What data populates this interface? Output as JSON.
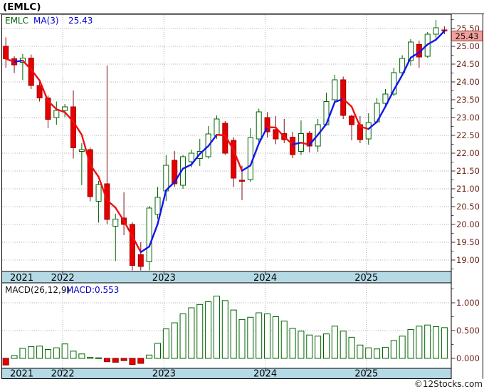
{
  "page": {
    "title": "(EMLC)",
    "copyright": "©12Stocks.com"
  },
  "main_chart": {
    "legend": {
      "symbol": "EMLC",
      "ma_label": "MA(3)",
      "ma_value": "25.43"
    },
    "last_price_box": "25.43",
    "y_axis": {
      "labels": [
        "25.50",
        "25.00",
        "24.50",
        "24.00",
        "23.50",
        "23.00",
        "22.50",
        "22.00",
        "21.50",
        "21.00",
        "20.50",
        "20.00",
        "19.50",
        "19.00"
      ]
    },
    "x_axis": {
      "labels": [
        "2021",
        "2022",
        "2023",
        "2024",
        "2025"
      ]
    }
  },
  "macd_panel": {
    "legend": {
      "label": "MACD(26,12,9)",
      "value": "MACD:0.553"
    },
    "y_axis": {
      "labels": [
        "1.000",
        "0.500",
        "0.000"
      ]
    },
    "x_axis": {
      "labels": [
        "2021",
        "2022",
        "2023",
        "2024",
        "2025"
      ]
    }
  },
  "colors": {
    "up_outline": "#006400",
    "down_fill": "#E60000",
    "down_edge": "#A00000",
    "wick_up": "#006400",
    "wick_down": "#7E0E10",
    "ma_up": "#1414EE",
    "ma_down": "#EE1010",
    "axis_label": "#6E241C",
    "year_label": "#000000",
    "strip_bg": "#B5DAE6",
    "grid": "#B0B0B0",
    "frame": "#000000",
    "price_box_bg": "#F1A09C",
    "price_box_border": "#9E3A33",
    "legend_symbol": "#006400",
    "legend_blue": "#0000CC",
    "macd_neg_fill": "#E60000",
    "macd_neg_edge": "#8B0000"
  },
  "chart_data": [
    {
      "type": "candlestick",
      "title": "(EMLC) monthly candlesticks with MA(3) overlay (line blue when rising, red when falling)",
      "x": [
        "2021-06",
        "2021-07",
        "2021-08",
        "2021-09",
        "2021-10",
        "2021-11",
        "2021-12",
        "2022-01",
        "2022-02",
        "2022-03",
        "2022-04",
        "2022-05",
        "2022-06",
        "2022-07",
        "2022-08",
        "2022-09",
        "2022-10",
        "2022-11",
        "2022-12",
        "2023-01",
        "2023-02",
        "2023-03",
        "2023-04",
        "2023-05",
        "2023-06",
        "2023-07",
        "2023-08",
        "2023-09",
        "2023-10",
        "2023-11",
        "2023-12",
        "2024-01",
        "2024-02",
        "2024-03",
        "2024-04",
        "2024-05",
        "2024-06",
        "2024-07",
        "2024-08",
        "2024-09",
        "2024-10",
        "2024-11",
        "2024-12",
        "2025-01",
        "2025-02",
        "2025-03",
        "2025-04",
        "2025-05",
        "2025-06",
        "2025-07",
        "2025-08",
        "2025-09",
        "2025-10"
      ],
      "ohlc": [
        [
          25.0,
          25.25,
          24.4,
          24.65
        ],
        [
          24.65,
          24.72,
          24.25,
          24.48
        ],
        [
          24.55,
          24.78,
          24.05,
          24.67
        ],
        [
          24.67,
          24.77,
          23.8,
          23.9
        ],
        [
          23.9,
          24.0,
          23.45,
          23.55
        ],
        [
          23.55,
          23.62,
          22.7,
          22.95
        ],
        [
          23.0,
          23.45,
          22.8,
          23.2
        ],
        [
          23.2,
          23.38,
          23.02,
          23.3
        ],
        [
          23.3,
          23.76,
          21.85,
          22.15
        ],
        [
          22.05,
          22.28,
          21.1,
          22.1
        ],
        [
          22.1,
          22.16,
          20.65,
          20.78
        ],
        [
          20.65,
          21.22,
          20.05,
          21.12
        ],
        [
          21.14,
          24.46,
          20.0,
          20.14
        ],
        [
          19.95,
          20.3,
          18.97,
          20.15
        ],
        [
          20.18,
          20.9,
          19.7,
          20.0
        ],
        [
          20.0,
          20.06,
          18.7,
          18.85
        ],
        [
          19.15,
          19.5,
          18.62,
          18.82
        ],
        [
          18.95,
          20.52,
          18.66,
          20.46
        ],
        [
          20.28,
          21.05,
          20.15,
          20.76
        ],
        [
          20.94,
          21.94,
          20.66,
          21.66
        ],
        [
          21.8,
          22.06,
          21.05,
          21.14
        ],
        [
          21.1,
          21.95,
          21.0,
          21.9
        ],
        [
          21.76,
          22.1,
          21.6,
          22.0
        ],
        [
          21.85,
          22.4,
          21.64,
          22.05
        ],
        [
          21.9,
          22.76,
          21.85,
          22.54
        ],
        [
          22.5,
          23.06,
          22.4,
          22.96
        ],
        [
          22.84,
          22.9,
          21.95,
          22.0
        ],
        [
          22.36,
          22.45,
          21.05,
          21.3
        ],
        [
          21.24,
          21.65,
          20.68,
          21.22
        ],
        [
          21.26,
          22.7,
          21.2,
          22.44
        ],
        [
          22.4,
          23.25,
          22.3,
          23.16
        ],
        [
          23.0,
          23.15,
          22.44,
          22.6
        ],
        [
          22.66,
          23.04,
          22.25,
          22.4
        ],
        [
          22.55,
          22.96,
          22.28,
          22.38
        ],
        [
          22.45,
          22.6,
          21.86,
          21.96
        ],
        [
          22.05,
          22.92,
          21.95,
          22.55
        ],
        [
          22.56,
          22.62,
          22.02,
          22.2
        ],
        [
          22.2,
          22.96,
          22.04,
          22.8
        ],
        [
          22.8,
          23.7,
          22.78,
          23.45
        ],
        [
          23.5,
          24.2,
          23.4,
          24.06
        ],
        [
          24.06,
          24.15,
          22.96,
          23.06
        ],
        [
          23.04,
          23.08,
          22.36,
          22.8
        ],
        [
          22.8,
          23.04,
          22.28,
          22.38
        ],
        [
          22.4,
          23.12,
          22.24,
          22.86
        ],
        [
          22.88,
          23.55,
          22.84,
          23.4
        ],
        [
          23.4,
          23.8,
          23.32,
          23.66
        ],
        [
          23.66,
          24.4,
          23.6,
          24.26
        ],
        [
          24.26,
          24.75,
          24.18,
          24.66
        ],
        [
          24.6,
          25.2,
          24.45,
          25.12
        ],
        [
          25.05,
          25.16,
          24.4,
          24.7
        ],
        [
          24.72,
          25.4,
          24.68,
          25.34
        ],
        [
          25.34,
          25.74,
          25.22,
          25.52
        ],
        [
          25.46,
          25.56,
          25.34,
          25.43
        ]
      ],
      "overlays": [
        {
          "name": "MA(3)",
          "derived": "3-period moving average of close",
          "last_value": 25.43
        }
      ],
      "ylabel": "",
      "xlabel": "",
      "ylim": [
        18.7,
        25.9
      ],
      "y_ticks": [
        19.0,
        19.5,
        20.0,
        20.5,
        21.0,
        21.5,
        22.0,
        22.5,
        23.0,
        23.5,
        24.0,
        24.5,
        25.0,
        25.5
      ],
      "grid": true,
      "legend_position": "top-left"
    },
    {
      "type": "bar",
      "title": "MACD(26,12,9) histogram",
      "x": [
        "2021-06",
        "2021-07",
        "2021-08",
        "2021-09",
        "2021-10",
        "2021-11",
        "2021-12",
        "2022-01",
        "2022-02",
        "2022-03",
        "2022-04",
        "2022-05",
        "2022-06",
        "2022-07",
        "2022-08",
        "2022-09",
        "2022-10",
        "2022-11",
        "2022-12",
        "2023-01",
        "2023-02",
        "2023-03",
        "2023-04",
        "2023-05",
        "2023-06",
        "2023-07",
        "2023-08",
        "2023-09",
        "2023-10",
        "2023-11",
        "2023-12",
        "2024-01",
        "2024-02",
        "2024-03",
        "2024-04",
        "2024-05",
        "2024-06",
        "2024-07",
        "2024-08",
        "2024-09",
        "2024-10",
        "2024-11",
        "2024-12",
        "2025-01",
        "2025-02",
        "2025-03",
        "2025-04",
        "2025-05",
        "2025-06",
        "2025-07",
        "2025-08",
        "2025-09",
        "2025-10"
      ],
      "values": [
        -0.12,
        0.05,
        0.18,
        0.21,
        0.22,
        0.16,
        0.19,
        0.26,
        0.13,
        0.08,
        0.02,
        0.01,
        -0.06,
        -0.07,
        -0.04,
        -0.11,
        -0.09,
        0.06,
        0.27,
        0.53,
        0.64,
        0.8,
        0.91,
        0.97,
        1.02,
        1.12,
        1.04,
        0.87,
        0.7,
        0.74,
        0.82,
        0.8,
        0.75,
        0.67,
        0.54,
        0.49,
        0.42,
        0.4,
        0.44,
        0.58,
        0.49,
        0.38,
        0.24,
        0.19,
        0.17,
        0.2,
        0.32,
        0.4,
        0.52,
        0.58,
        0.6,
        0.57,
        0.553
      ],
      "last_value": 0.553,
      "ylim": [
        -0.18,
        1.35
      ],
      "y_ticks": [
        0.0,
        0.5,
        1.0
      ],
      "bar_style": "hollow green outline when >= 0, solid red when < 0"
    }
  ]
}
